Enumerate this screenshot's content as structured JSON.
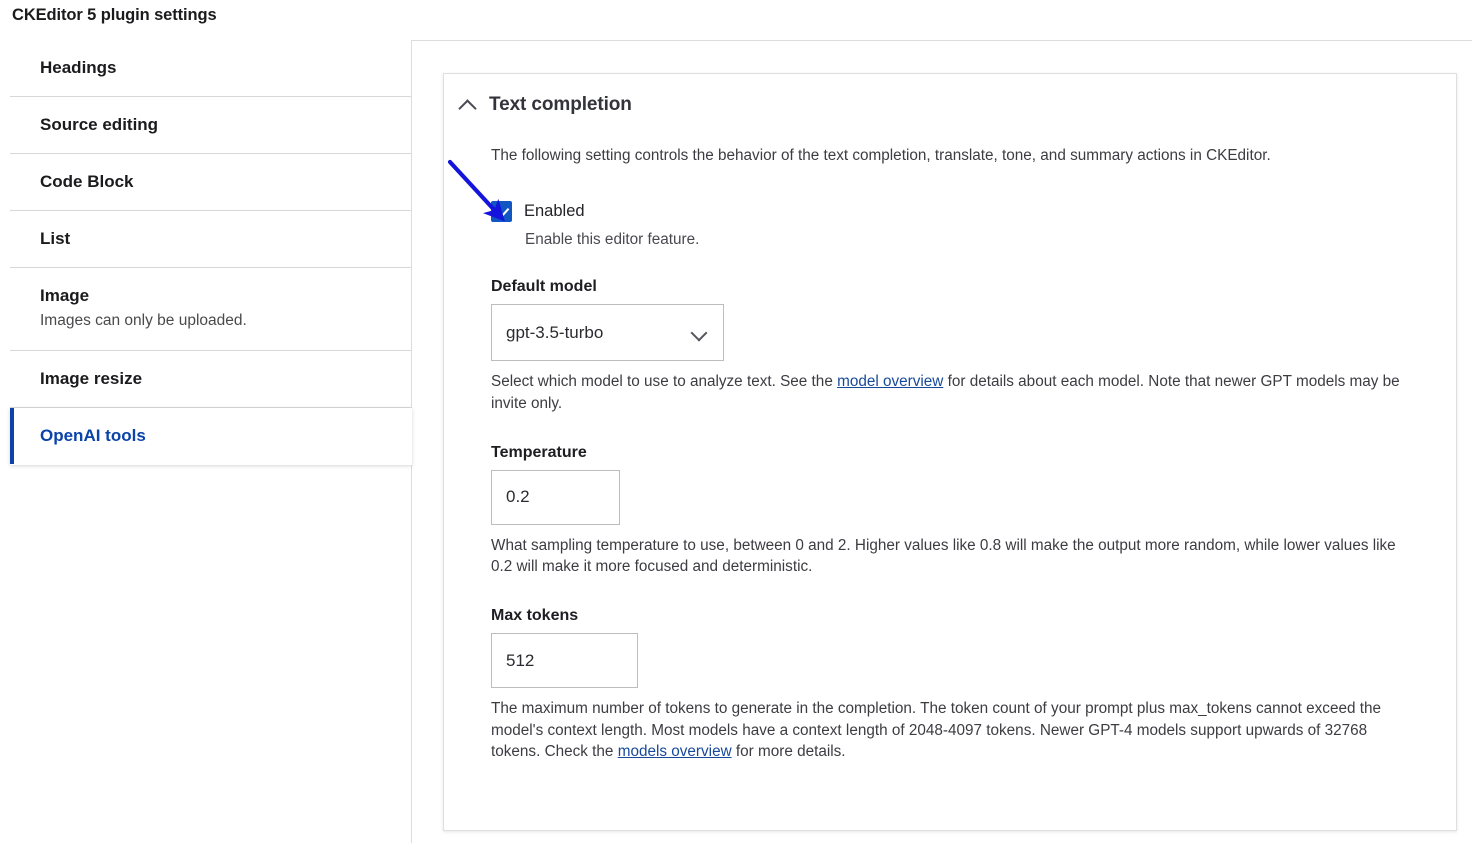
{
  "page": {
    "title": "CKEditor 5 plugin settings"
  },
  "sidebar": {
    "items": [
      {
        "label": "Headings",
        "summary": ""
      },
      {
        "label": "Source editing",
        "summary": ""
      },
      {
        "label": "Code Block",
        "summary": ""
      },
      {
        "label": "List",
        "summary": ""
      },
      {
        "label": "Image",
        "summary": "Images can only be uploaded."
      },
      {
        "label": "Image resize",
        "summary": ""
      },
      {
        "label": "OpenAI tools",
        "summary": "",
        "active": true
      }
    ]
  },
  "card": {
    "title": "Text completion",
    "collapse_icon": "chevron-up-icon",
    "intro": "The following setting controls the behavior of the text completion, translate, tone, and summary actions in CKEditor.",
    "enabled": {
      "label": "Enabled",
      "help": "Enable this editor feature.",
      "checked": true
    },
    "default_model": {
      "label": "Default model",
      "value": "gpt-3.5-turbo",
      "dropdown_icon": "chevron-down-icon",
      "help_before": "Select which model to use to analyze text. See the ",
      "help_link": "model overview",
      "help_after": " for details about each model. Note that newer GPT models may be invite only."
    },
    "temperature": {
      "label": "Temperature",
      "value": "0.2",
      "help": "What sampling temperature to use, between 0 and 2. Higher values like 0.8 will make the output more random, while lower values like 0.2 will make it more focused and deterministic."
    },
    "max_tokens": {
      "label": "Max tokens",
      "value": "512",
      "help_before": "The maximum number of tokens to generate in the completion. The token count of your prompt plus max_tokens cannot exceed the model's context length. Most models have a context length of 2048-4097 tokens. Newer GPT-4 models support upwards of 32768 tokens. Check the ",
      "help_link": "models overview",
      "help_after": " for more details."
    }
  },
  "annotation": {
    "arrow_color": "#1414dc",
    "arrow_name": "pointer-arrow"
  },
  "colors": {
    "accent": "#0b43a8",
    "checkbox": "#1256c4",
    "link": "#17499b",
    "annotation": "#1414dc"
  }
}
